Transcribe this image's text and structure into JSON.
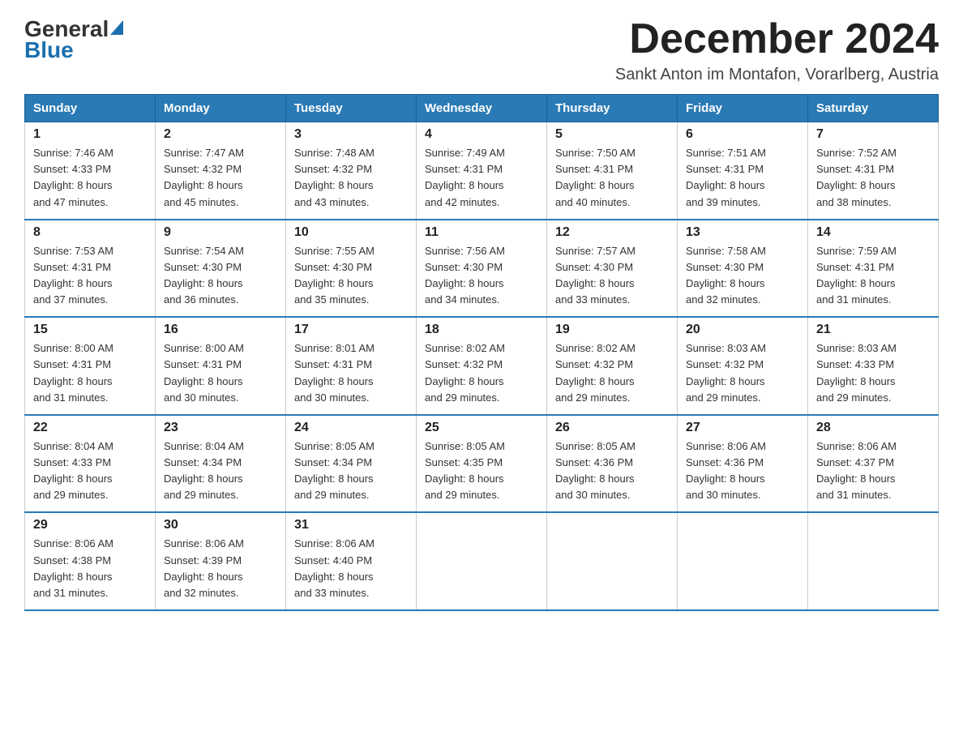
{
  "header": {
    "logo_general": "General",
    "logo_blue": "Blue",
    "month_title": "December 2024",
    "subtitle": "Sankt Anton im Montafon, Vorarlberg, Austria"
  },
  "weekdays": [
    "Sunday",
    "Monday",
    "Tuesday",
    "Wednesday",
    "Thursday",
    "Friday",
    "Saturday"
  ],
  "weeks": [
    [
      {
        "day": "1",
        "sunrise": "7:46 AM",
        "sunset": "4:33 PM",
        "daylight": "8 hours and 47 minutes."
      },
      {
        "day": "2",
        "sunrise": "7:47 AM",
        "sunset": "4:32 PM",
        "daylight": "8 hours and 45 minutes."
      },
      {
        "day": "3",
        "sunrise": "7:48 AM",
        "sunset": "4:32 PM",
        "daylight": "8 hours and 43 minutes."
      },
      {
        "day": "4",
        "sunrise": "7:49 AM",
        "sunset": "4:31 PM",
        "daylight": "8 hours and 42 minutes."
      },
      {
        "day": "5",
        "sunrise": "7:50 AM",
        "sunset": "4:31 PM",
        "daylight": "8 hours and 40 minutes."
      },
      {
        "day": "6",
        "sunrise": "7:51 AM",
        "sunset": "4:31 PM",
        "daylight": "8 hours and 39 minutes."
      },
      {
        "day": "7",
        "sunrise": "7:52 AM",
        "sunset": "4:31 PM",
        "daylight": "8 hours and 38 minutes."
      }
    ],
    [
      {
        "day": "8",
        "sunrise": "7:53 AM",
        "sunset": "4:31 PM",
        "daylight": "8 hours and 37 minutes."
      },
      {
        "day": "9",
        "sunrise": "7:54 AM",
        "sunset": "4:30 PM",
        "daylight": "8 hours and 36 minutes."
      },
      {
        "day": "10",
        "sunrise": "7:55 AM",
        "sunset": "4:30 PM",
        "daylight": "8 hours and 35 minutes."
      },
      {
        "day": "11",
        "sunrise": "7:56 AM",
        "sunset": "4:30 PM",
        "daylight": "8 hours and 34 minutes."
      },
      {
        "day": "12",
        "sunrise": "7:57 AM",
        "sunset": "4:30 PM",
        "daylight": "8 hours and 33 minutes."
      },
      {
        "day": "13",
        "sunrise": "7:58 AM",
        "sunset": "4:30 PM",
        "daylight": "8 hours and 32 minutes."
      },
      {
        "day": "14",
        "sunrise": "7:59 AM",
        "sunset": "4:31 PM",
        "daylight": "8 hours and 31 minutes."
      }
    ],
    [
      {
        "day": "15",
        "sunrise": "8:00 AM",
        "sunset": "4:31 PM",
        "daylight": "8 hours and 31 minutes."
      },
      {
        "day": "16",
        "sunrise": "8:00 AM",
        "sunset": "4:31 PM",
        "daylight": "8 hours and 30 minutes."
      },
      {
        "day": "17",
        "sunrise": "8:01 AM",
        "sunset": "4:31 PM",
        "daylight": "8 hours and 30 minutes."
      },
      {
        "day": "18",
        "sunrise": "8:02 AM",
        "sunset": "4:32 PM",
        "daylight": "8 hours and 29 minutes."
      },
      {
        "day": "19",
        "sunrise": "8:02 AM",
        "sunset": "4:32 PM",
        "daylight": "8 hours and 29 minutes."
      },
      {
        "day": "20",
        "sunrise": "8:03 AM",
        "sunset": "4:32 PM",
        "daylight": "8 hours and 29 minutes."
      },
      {
        "day": "21",
        "sunrise": "8:03 AM",
        "sunset": "4:33 PM",
        "daylight": "8 hours and 29 minutes."
      }
    ],
    [
      {
        "day": "22",
        "sunrise": "8:04 AM",
        "sunset": "4:33 PM",
        "daylight": "8 hours and 29 minutes."
      },
      {
        "day": "23",
        "sunrise": "8:04 AM",
        "sunset": "4:34 PM",
        "daylight": "8 hours and 29 minutes."
      },
      {
        "day": "24",
        "sunrise": "8:05 AM",
        "sunset": "4:34 PM",
        "daylight": "8 hours and 29 minutes."
      },
      {
        "day": "25",
        "sunrise": "8:05 AM",
        "sunset": "4:35 PM",
        "daylight": "8 hours and 29 minutes."
      },
      {
        "day": "26",
        "sunrise": "8:05 AM",
        "sunset": "4:36 PM",
        "daylight": "8 hours and 30 minutes."
      },
      {
        "day": "27",
        "sunrise": "8:06 AM",
        "sunset": "4:36 PM",
        "daylight": "8 hours and 30 minutes."
      },
      {
        "day": "28",
        "sunrise": "8:06 AM",
        "sunset": "4:37 PM",
        "daylight": "8 hours and 31 minutes."
      }
    ],
    [
      {
        "day": "29",
        "sunrise": "8:06 AM",
        "sunset": "4:38 PM",
        "daylight": "8 hours and 31 minutes."
      },
      {
        "day": "30",
        "sunrise": "8:06 AM",
        "sunset": "4:39 PM",
        "daylight": "8 hours and 32 minutes."
      },
      {
        "day": "31",
        "sunrise": "8:06 AM",
        "sunset": "4:40 PM",
        "daylight": "8 hours and 33 minutes."
      },
      null,
      null,
      null,
      null
    ]
  ],
  "labels": {
    "sunrise": "Sunrise:",
    "sunset": "Sunset:",
    "daylight": "Daylight:"
  }
}
